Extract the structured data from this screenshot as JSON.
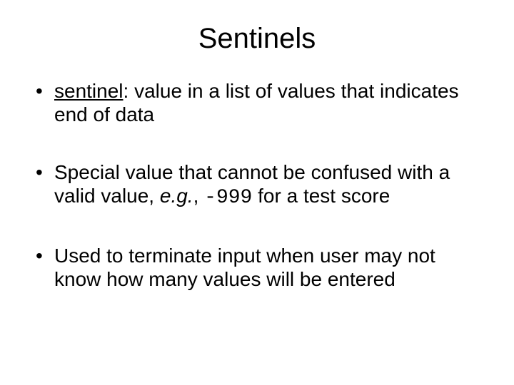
{
  "title": "Sentinels",
  "bullets": {
    "b1_term": "sentinel",
    "b1_rest": ": value in a list of values that indicates end of data",
    "b2_a": "Special value that cannot be confused with a valid value, ",
    "b2_eg": "e.g.",
    "b2_b": ", ",
    "b2_code": "-999",
    "b2_c": " for a test score",
    "b3": "Used to terminate input when user may not know how many values will be entered"
  }
}
